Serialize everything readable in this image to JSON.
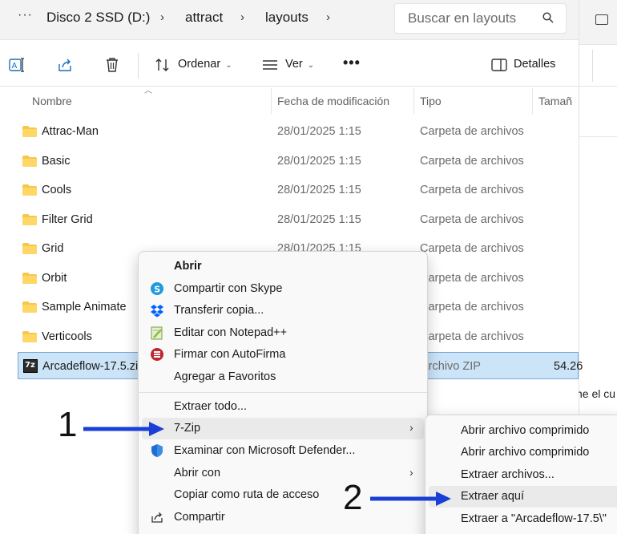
{
  "address": {
    "more": "···",
    "crumbs": [
      "Disco 2 SSD (D:)",
      "attract",
      "layouts"
    ],
    "search_placeholder": "Buscar en layouts"
  },
  "commandbar": {
    "sort_label": "Ordenar",
    "view_label": "Ver",
    "more_label": "•••",
    "details_label": "Detalles"
  },
  "columns": {
    "name": "Nombre",
    "date": "Fecha de modificación",
    "type": "Tipo",
    "size": "Tamañ"
  },
  "rows": [
    {
      "name": "Attrac-Man",
      "date": "28/01/2025 1:15",
      "type": "Carpeta de archivos",
      "size": ""
    },
    {
      "name": "Basic",
      "date": "28/01/2025 1:15",
      "type": "Carpeta de archivos",
      "size": ""
    },
    {
      "name": "Cools",
      "date": "28/01/2025 1:15",
      "type": "Carpeta de archivos",
      "size": ""
    },
    {
      "name": "Filter Grid",
      "date": "28/01/2025 1:15",
      "type": "Carpeta de archivos",
      "size": ""
    },
    {
      "name": "Grid",
      "date": "28/01/2025 1:15",
      "type": "Carpeta de archivos",
      "size": ""
    },
    {
      "name": "Orbit",
      "date": "",
      "type": "Carpeta de archivos",
      "size": ""
    },
    {
      "name": "Sample Animate",
      "date": "",
      "type": "Carpeta de archivos",
      "size": ""
    },
    {
      "name": "Verticools",
      "date": "",
      "type": "Carpeta de archivos",
      "size": ""
    },
    {
      "name": "Arcadeflow-17.5.zi",
      "date": "",
      "type": "Archivo ZIP",
      "size": "54.26"
    }
  ],
  "zip_icon_text": "7z",
  "context_menu": {
    "items": [
      {
        "label": "Abrir"
      },
      {
        "label": "Compartir con Skype"
      },
      {
        "label": "Transferir copia..."
      },
      {
        "label": "Editar con Notepad++"
      },
      {
        "label": "Firmar con AutoFirma"
      },
      {
        "label": "Agregar a Favoritos"
      },
      {
        "label": "Extraer todo..."
      },
      {
        "label": "7-Zip"
      },
      {
        "label": "Examinar con Microsoft Defender..."
      },
      {
        "label": "Abrir con"
      },
      {
        "label": "Copiar como ruta de acceso"
      },
      {
        "label": "Compartir"
      }
    ]
  },
  "submenu_7zip": {
    "items": [
      {
        "label": "Abrir archivo comprimido"
      },
      {
        "label": "Abrir archivo comprimido"
      },
      {
        "label": "Extraer archivos..."
      },
      {
        "label": "Extraer aquí"
      },
      {
        "label": "Extraer a \"Arcadeflow-17.5\\\""
      }
    ]
  },
  "side_window_text": "ne el cu",
  "annotations": [
    "1",
    "2"
  ],
  "colors": {
    "accent_arrow": "#1a3fd6",
    "selection_bg": "#cce4f7",
    "folder": "#f7c64a"
  }
}
